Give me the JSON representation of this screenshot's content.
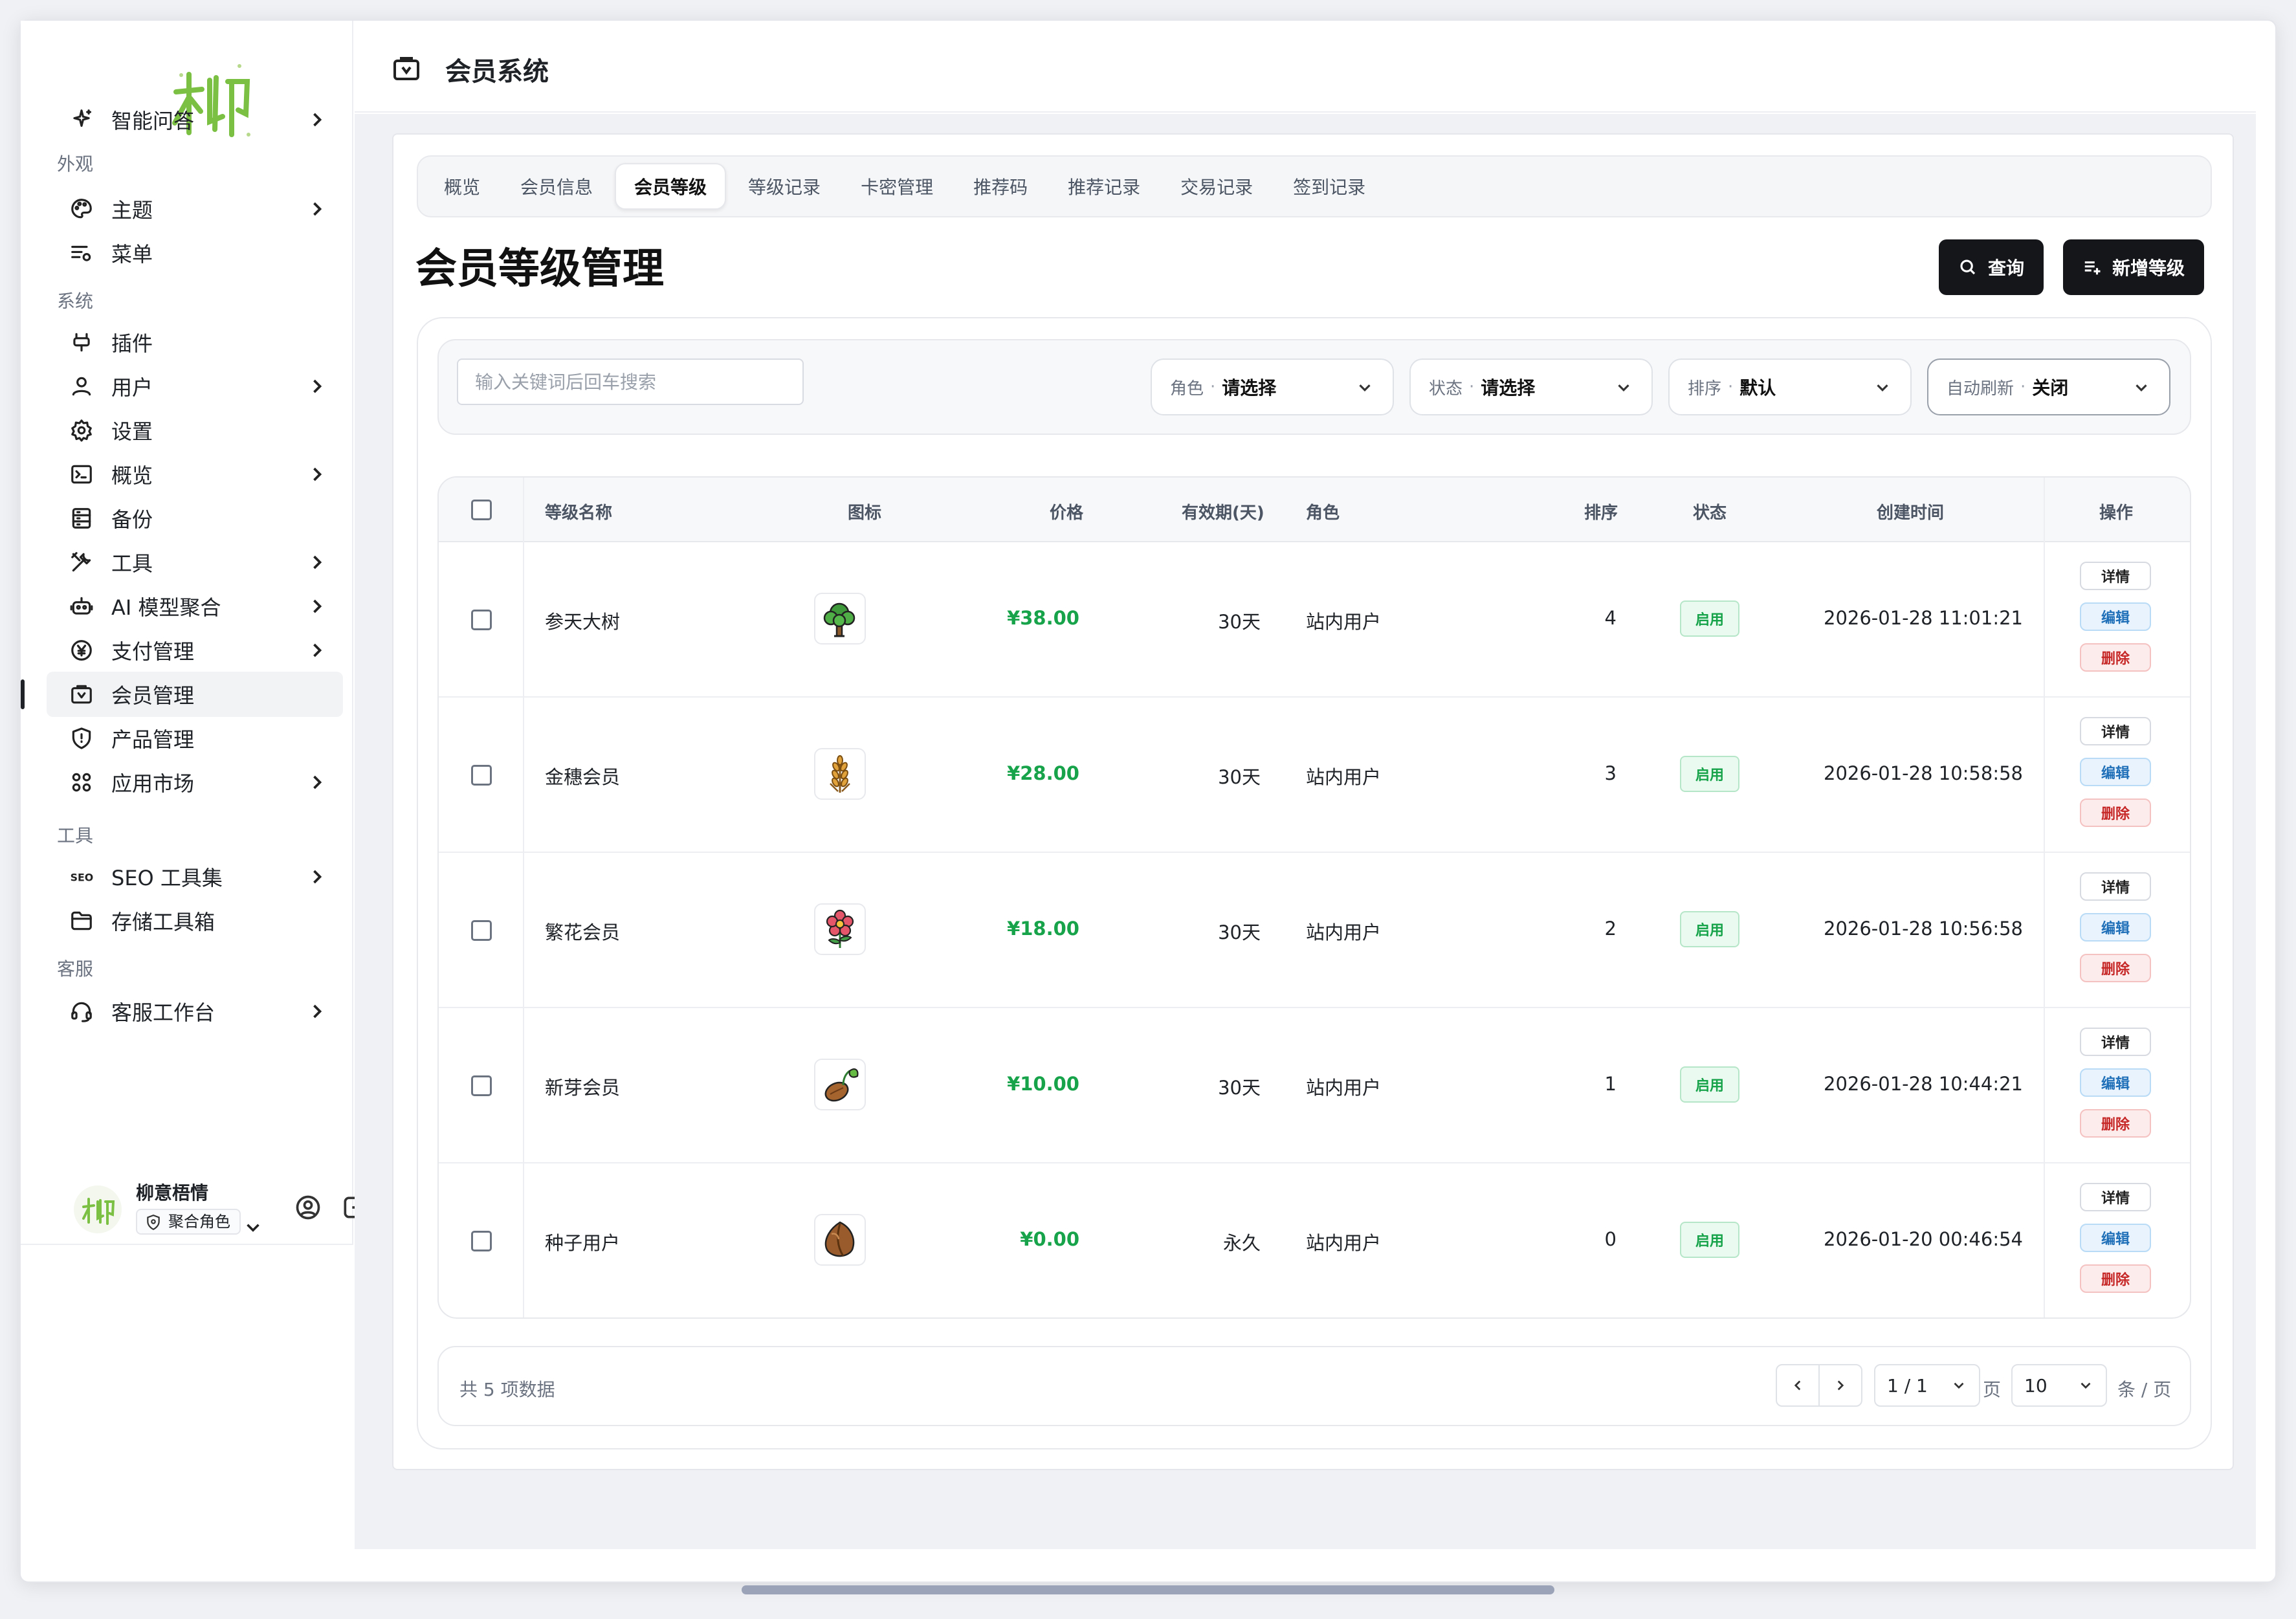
{
  "header": {
    "title": "会员系统"
  },
  "sidebar": {
    "groups": {
      "appearance": "外观",
      "system": "系统",
      "tools": "工具",
      "service": "客服"
    },
    "items": [
      {
        "label": "智能问答",
        "icon": "sparkle-icon",
        "chevron": true
      },
      {
        "label": "主题",
        "icon": "palette-icon",
        "chevron": true
      },
      {
        "label": "菜单",
        "icon": "menu-settings-icon",
        "chevron": false
      },
      {
        "label": "插件",
        "icon": "plugin-icon",
        "chevron": false
      },
      {
        "label": "用户",
        "icon": "user-icon",
        "chevron": true
      },
      {
        "label": "设置",
        "icon": "gear-icon",
        "chevron": false
      },
      {
        "label": "概览",
        "icon": "terminal-icon",
        "chevron": true
      },
      {
        "label": "备份",
        "icon": "backup-icon",
        "chevron": false
      },
      {
        "label": "工具",
        "icon": "tools-icon",
        "chevron": true
      },
      {
        "label": "AI 模型聚合",
        "icon": "robot-icon",
        "chevron": true
      },
      {
        "label": "支付管理",
        "icon": "yen-circle-icon",
        "chevron": true
      },
      {
        "label": "会员管理",
        "icon": "member-folder-icon",
        "chevron": false,
        "active": true
      },
      {
        "label": "产品管理",
        "icon": "shield-icon",
        "chevron": false
      },
      {
        "label": "应用市场",
        "icon": "apps-grid-icon",
        "chevron": true
      },
      {
        "label": "SEO 工具集",
        "icon": "seo-icon",
        "chevron": true
      },
      {
        "label": "存储工具箱",
        "icon": "folder-icon",
        "chevron": false
      },
      {
        "label": "客服工作台",
        "icon": "headset-icon",
        "chevron": true
      }
    ],
    "user": {
      "name": "柳意梧情",
      "role": "聚合角色"
    }
  },
  "tabs": [
    {
      "label": "概览"
    },
    {
      "label": "会员信息"
    },
    {
      "label": "会员等级",
      "active": true
    },
    {
      "label": "等级记录"
    },
    {
      "label": "卡密管理"
    },
    {
      "label": "推荐码"
    },
    {
      "label": "推荐记录"
    },
    {
      "label": "交易记录"
    },
    {
      "label": "签到记录"
    }
  ],
  "page": {
    "title": "会员等级管理",
    "query_label": "查询",
    "add_label": "新增等级"
  },
  "filters": {
    "search_placeholder": "输入关键词后回车搜索",
    "role": {
      "label": "角色",
      "value": "请选择"
    },
    "status": {
      "label": "状态",
      "value": "请选择"
    },
    "sort": {
      "label": "排序",
      "value": "默认"
    },
    "refresh": {
      "label": "自动刷新",
      "value": "关闭"
    }
  },
  "table": {
    "headers": {
      "name": "等级名称",
      "icon": "图标",
      "price": "价格",
      "validity": "有效期(天)",
      "role": "角色",
      "sort": "排序",
      "status": "状态",
      "created": "创建时间",
      "actions": "操作"
    },
    "actions": {
      "detail": "详情",
      "edit": "编辑",
      "delete": "删除"
    },
    "rows": [
      {
        "name": "参天大树",
        "icon": "tree-icon",
        "price": "¥38.00",
        "validity": "30天",
        "role": "站内用户",
        "sort": "4",
        "status": "启用",
        "created": "2026-01-28 11:01:21"
      },
      {
        "name": "金穗会员",
        "icon": "wheat-icon",
        "price": "¥28.00",
        "validity": "30天",
        "role": "站内用户",
        "sort": "3",
        "status": "启用",
        "created": "2026-01-28 10:58:58"
      },
      {
        "name": "繁花会员",
        "icon": "flower-icon",
        "price": "¥18.00",
        "validity": "30天",
        "role": "站内用户",
        "sort": "2",
        "status": "启用",
        "created": "2026-01-28 10:56:58"
      },
      {
        "name": "新芽会员",
        "icon": "sprout-icon",
        "price": "¥10.00",
        "validity": "30天",
        "role": "站内用户",
        "sort": "1",
        "status": "启用",
        "created": "2026-01-28 10:44:21"
      },
      {
        "name": "种子用户",
        "icon": "seed-icon",
        "price": "¥0.00",
        "validity": "永久",
        "role": "站内用户",
        "sort": "0",
        "status": "启用",
        "created": "2026-01-20 00:46:54"
      }
    ]
  },
  "pagination": {
    "total": "共 5 项数据",
    "page": "1 / 1",
    "page_unit": "页",
    "size": "10",
    "size_unit": "条 / 页"
  },
  "colors": {
    "accent": "#14161a",
    "price": "#16a34a",
    "edit": "#1e6fb8",
    "delete": "#c62828",
    "logo": "#7bc043"
  }
}
